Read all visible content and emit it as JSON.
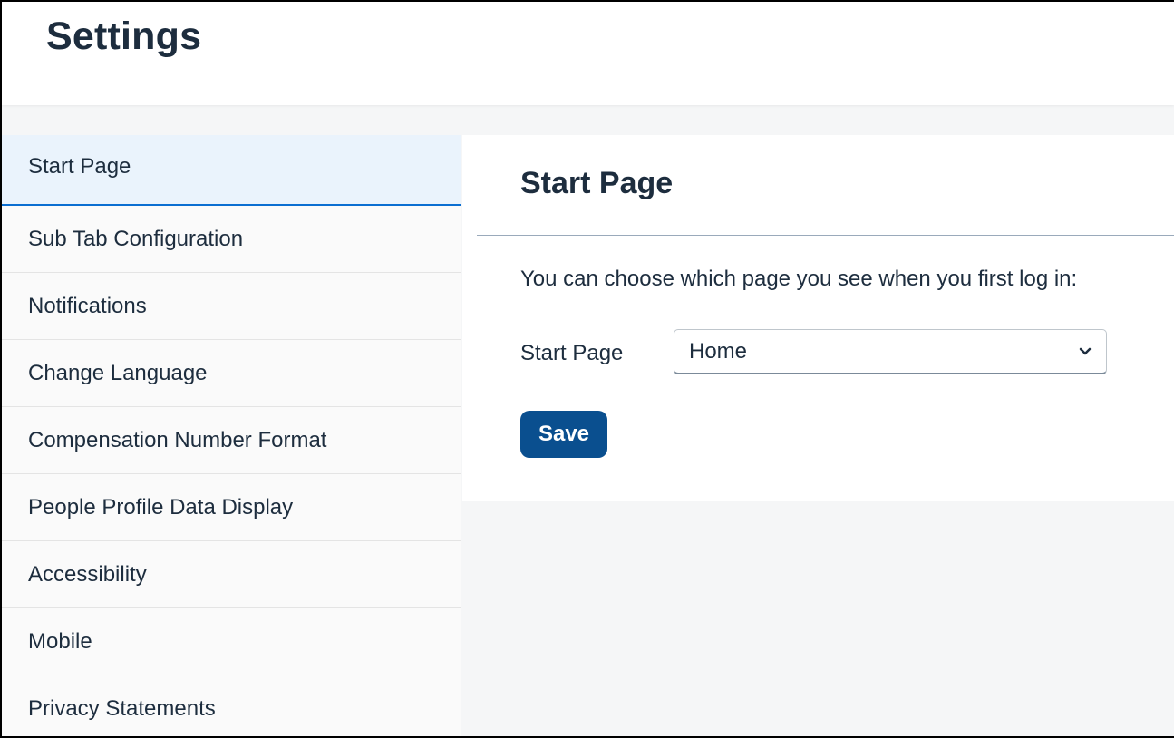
{
  "header": {
    "title": "Settings"
  },
  "sidebar": {
    "items": [
      {
        "label": "Start Page",
        "active": true
      },
      {
        "label": "Sub Tab Configuration",
        "active": false
      },
      {
        "label": "Notifications",
        "active": false
      },
      {
        "label": "Change Language",
        "active": false
      },
      {
        "label": "Compensation Number Format",
        "active": false
      },
      {
        "label": "People Profile Data Display",
        "active": false
      },
      {
        "label": "Accessibility",
        "active": false
      },
      {
        "label": "Mobile",
        "active": false
      },
      {
        "label": "Privacy Statements",
        "active": false
      }
    ]
  },
  "main": {
    "section_title": "Start Page",
    "description": "You can choose which page you see when you first log in:",
    "field_label": "Start Page",
    "select": {
      "value": "Home",
      "icon": "chevron-down-icon"
    },
    "save_label": "Save"
  },
  "colors": {
    "accent": "#0a6ed1",
    "button": "#0a4f8f",
    "active_item_bg": "#eaf3fc",
    "page_bg": "#f5f6f7"
  }
}
